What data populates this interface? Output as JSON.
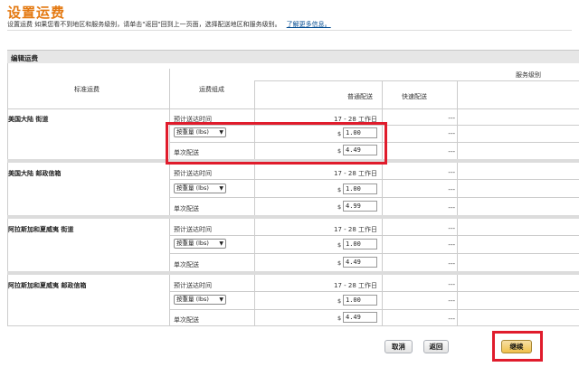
{
  "page": {
    "title": "设置运费",
    "intro": "设置运费  如果您看不到地区和服务级别，请单击\"返回\"回到上一页面，选择配送地区和服务级别。",
    "more_link": "了解更多信息。"
  },
  "section": {
    "title": "编辑运费"
  },
  "columns": {
    "service_level": "服务级别",
    "standard_shipping": "标准运费",
    "fee_composition": "运费组成",
    "regular_delivery": "普通配送",
    "express_delivery": "快速配送"
  },
  "rows": [
    {
      "region": "美国大陆 街道",
      "eta_label": "预计送达时间",
      "eta_value": "17 - 28 工作日",
      "weight_select": "按重量 (lbs)",
      "per_weight_value": "1.00",
      "per_shipment_label": "单次配送",
      "per_shipment_value": "4.49",
      "express_dash": "---"
    },
    {
      "region": "美国大陆 邮政信箱",
      "eta_label": "预计送达时间",
      "eta_value": "17 - 28 工作日",
      "weight_select": "按重量 (lbs)",
      "per_weight_value": "1.00",
      "per_shipment_label": "单次配送",
      "per_shipment_value": "4.99",
      "express_dash": "---"
    },
    {
      "region": "阿拉斯加和夏威夷 街道",
      "eta_label": "预计送达时间",
      "eta_value": "17 - 28 工作日",
      "weight_select": "按重量 (lbs)",
      "per_weight_value": "1.00",
      "per_shipment_label": "单次配送",
      "per_shipment_value": "4.49",
      "express_dash": "---"
    },
    {
      "region": "阿拉斯加和夏威夷 邮政信箱",
      "eta_label": "预计送达时间",
      "eta_value": "17 - 28 工作日",
      "weight_select": "按重量 (lbs)",
      "per_weight_value": "1.00",
      "per_shipment_label": "单次配送",
      "per_shipment_value": "4.49",
      "express_dash": "---"
    }
  ],
  "currency_symbol": "$",
  "buttons": {
    "cancel": "取消",
    "back": "返回",
    "continue": "继续"
  },
  "colors": {
    "title": "#e47911",
    "highlight": "#e01c2c",
    "primary_button": "#f0c14b"
  },
  "icons": {
    "select_chevron": "chevron-down-icon"
  }
}
